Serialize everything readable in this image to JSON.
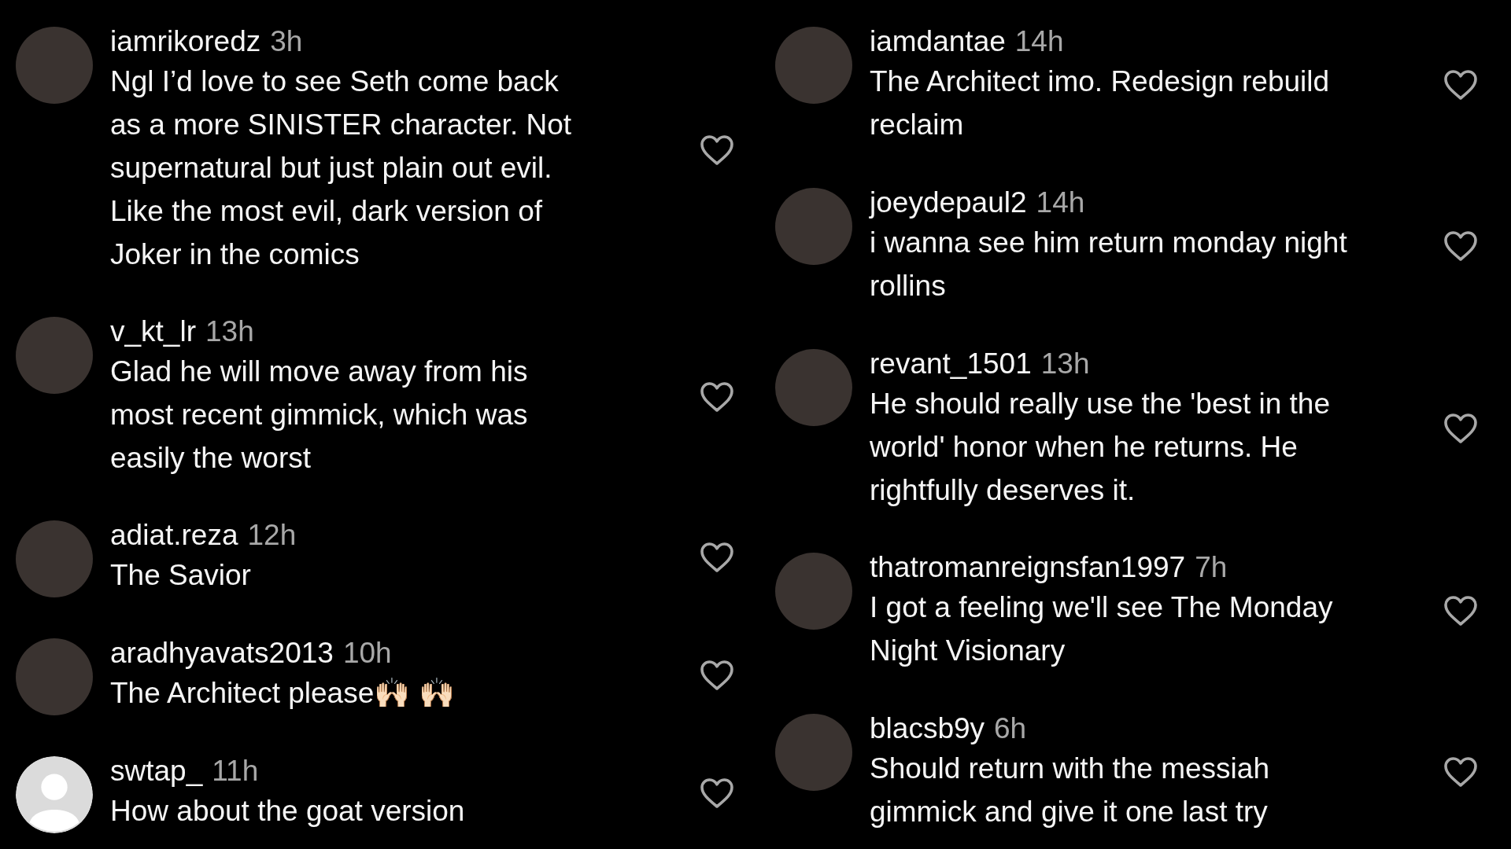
{
  "columns": [
    {
      "comments": [
        {
          "kind": "photo",
          "username": "iamrikoredz",
          "time": "3h",
          "text": "Ngl I’d love to see Seth come back as a more SINISTER character. Not supernatural but just plain out evil. Like the most evil, dark version of Joker in the comics"
        },
        {
          "kind": "photo",
          "username": "v_kt_lr",
          "time": "13h",
          "text": "Glad he will move away from his most recent gimmick, which was easily the worst"
        },
        {
          "kind": "photo",
          "username": "adiat.reza",
          "time": "12h",
          "text": "The Savior"
        },
        {
          "kind": "photo",
          "username": "aradhyavats2013",
          "time": "10h",
          "text": "The Architect please🙌🏻 🙌🏻"
        },
        {
          "kind": "default",
          "username": "swtap_",
          "time": "11h",
          "text": "How about the goat version"
        }
      ]
    },
    {
      "comments": [
        {
          "kind": "photo",
          "username": "iamdantae",
          "time": "14h",
          "text": "The Architect imo. Redesign rebuild reclaim"
        },
        {
          "kind": "photo",
          "username": "joeydepaul2",
          "time": "14h",
          "text": "i wanna see him return monday night rollins"
        },
        {
          "kind": "photo",
          "username": "revant_1501",
          "time": "13h",
          "text": "He should really use the 'best in the world' honor when he returns. He rightfully deserves it."
        },
        {
          "kind": "photo",
          "username": "thatromanreignsfan1997",
          "time": "7h",
          "text": "I got a feeling we'll see The Monday Night Visionary"
        },
        {
          "kind": "photo",
          "username": "blacsb9y",
          "time": "6h",
          "text": "Should return with the messiah gimmick and give it one last try"
        }
      ]
    }
  ]
}
